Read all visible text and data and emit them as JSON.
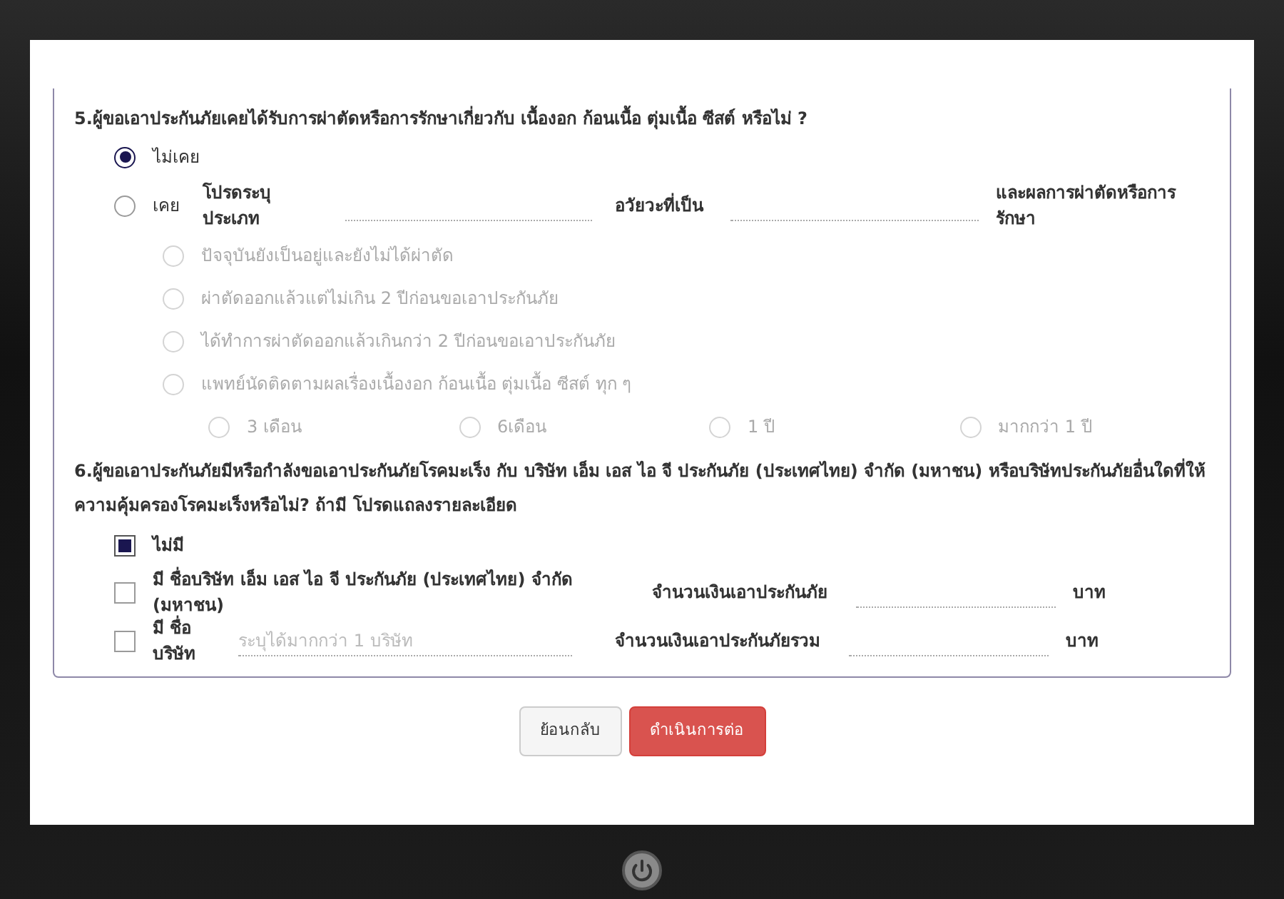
{
  "q5": {
    "title": "5.ผู้ขอเอาประกันภัยเคยได้รับการผ่าตัดหรือการรักษาเกี่ยวกับ เนื้องอก ก้อนเนื้อ ตุ่มเนื้อ ซีสต์ หรือไม่ ?",
    "options": [
      {
        "kind": "plain",
        "label": "ไม่เคย",
        "selected": true
      },
      {
        "kind": "detail",
        "label": "เคย",
        "selected": false,
        "prompts": [
          "โปรดระบุประเภท",
          "อวัยวะที่เป็น",
          "และผลการผ่าตัดหรือการรักษา"
        ]
      }
    ],
    "sub_options": [
      {
        "label": "ปัจจุบันยังเป็นอยู่และยังไม่ได้ผ่าตัด",
        "selected": false,
        "disabled": true
      },
      {
        "label": "ผ่าตัดออกแล้วแต่ไม่เกิน 2 ปีก่อนขอเอาประกันภัย",
        "selected": false,
        "disabled": true
      },
      {
        "label": "ได้ทำการผ่าตัดออกแล้วเกินกว่า 2 ปีก่อนขอเอาประกันภัย",
        "selected": false,
        "disabled": true
      },
      {
        "label": "แพทย์นัดติดตามผลเรื่องเนื้องอก ก้อนเนื้อ ตุ่มเนื้อ ซีสต์ ทุก ๆ",
        "selected": false,
        "disabled": true
      }
    ],
    "followup_options": [
      {
        "label": "3 เดือน",
        "selected": false,
        "disabled": true
      },
      {
        "label": "6เดือน",
        "selected": false,
        "disabled": true
      },
      {
        "label": "1 ปี",
        "selected": false,
        "disabled": true
      },
      {
        "label": "มากกว่า 1 ปี",
        "selected": false,
        "disabled": true
      }
    ]
  },
  "q6": {
    "title": "6.ผู้ขอเอาประกันภัยมีหรือกำลังขอเอาประกันภัยโรคมะเร็ง กับ บริษัท เอ็ม เอส ไอ จี ประกันภัย (ประเทศไทย) จำกัด (มหาชน) หรือบริษัทประกันภัยอื่นใดที่ให้ความคุ้มครองโรคมะเร็งหรือไม่? ถ้ามี โปรดแถลงรายละเอียด",
    "options": [
      {
        "kind": "plain",
        "label": "ไม่มี",
        "checked": true
      },
      {
        "kind": "company",
        "label": "มี ชื่อบริษัท เอ็ม เอส ไอ จี ประกันภัย (ประเทศไทย) จำกัด (มหาชน)",
        "checked": false,
        "amount_label": "จำนวนเงินเอาประกันภัย",
        "unit": "บาท"
      },
      {
        "kind": "other",
        "label": "มี ชื่อบริษัท",
        "checked": false,
        "placeholder": "ระบุได้มากกว่า 1 บริษัท",
        "amount_label": "จำนวนเงินเอาประกันภัยรวม",
        "unit": "บาท"
      }
    ]
  },
  "buttons": [
    {
      "label": "ย้อนกลับ",
      "kind": "secondary"
    },
    {
      "label": "ดำเนินการต่อ",
      "kind": "primary"
    }
  ]
}
